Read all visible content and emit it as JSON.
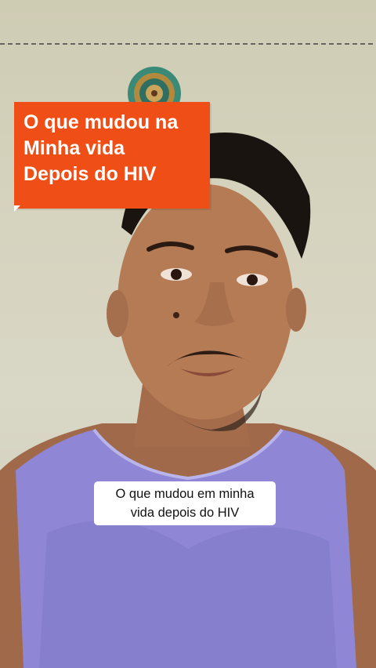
{
  "title_card": {
    "lines": [
      "O que mudou na",
      "Minha vida",
      "Depois do HIV"
    ],
    "background_color": "#ef4f16",
    "text_color": "#ffffff"
  },
  "caption": {
    "lines": [
      "O que mudou em minha",
      "vida depois do HIV"
    ]
  },
  "scene": {
    "subject": "person-speaking-to-camera",
    "shirt_color": "#8f87d6",
    "wall_color": "#d6d4bf"
  }
}
